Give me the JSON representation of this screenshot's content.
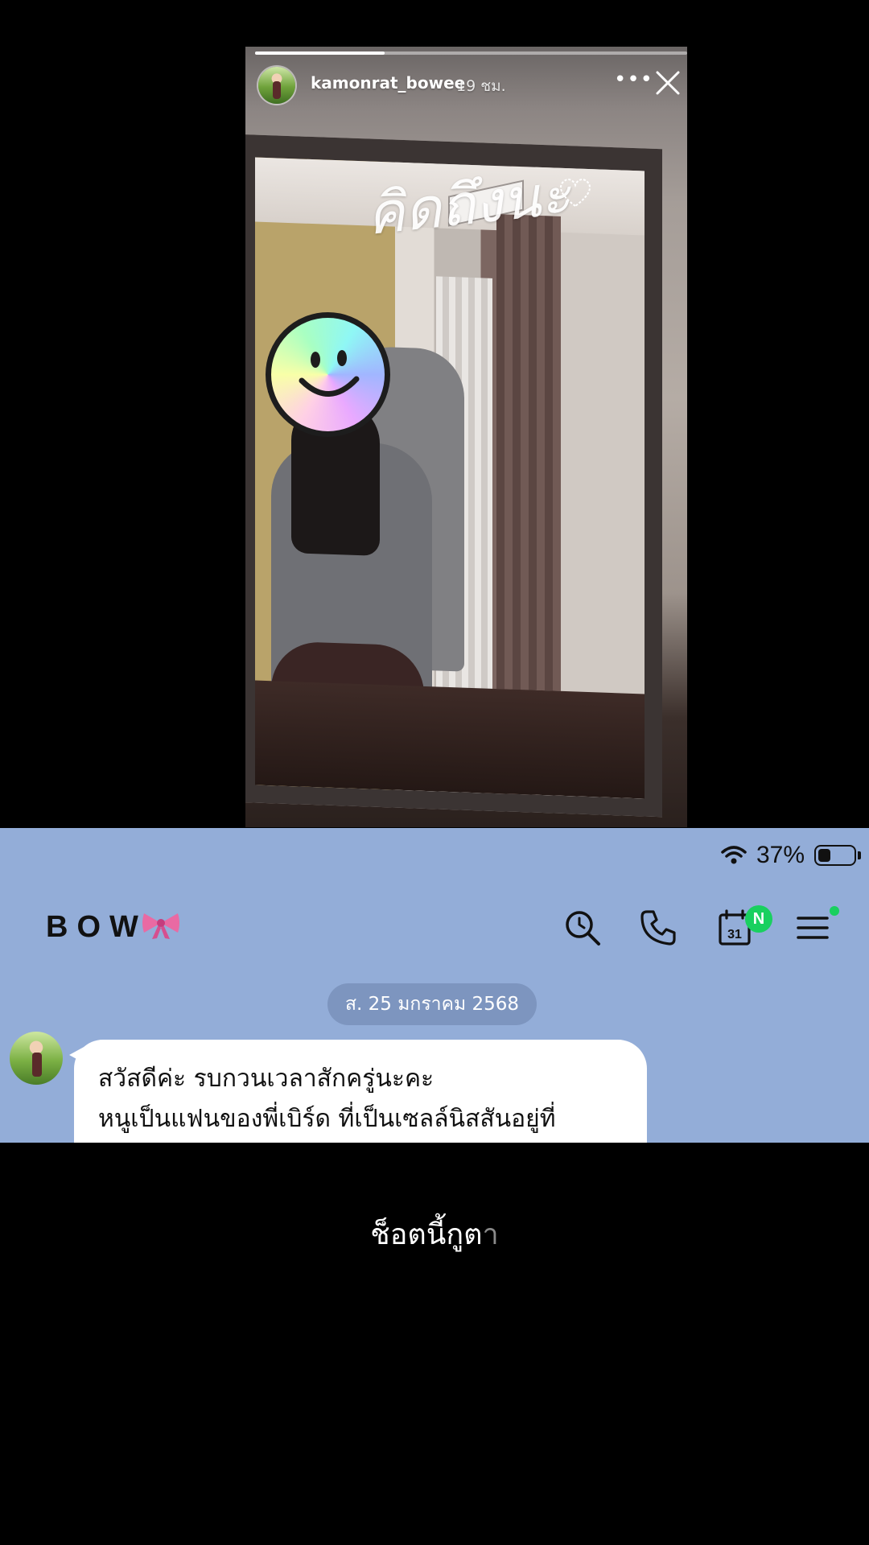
{
  "story": {
    "username": "kamonrat_bowee",
    "time_ago": "19 ชม.",
    "progress": 0.3,
    "caption": "คิดถึงนะ",
    "more_icon": "more-dots-icon",
    "close_icon": "close-icon"
  },
  "chat": {
    "status": {
      "battery_percent": "37%",
      "battery_level": 0.37
    },
    "title": "BOW",
    "title_icon": "bow-ribbon-icon",
    "header_icons": [
      "search-icon",
      "phone-icon",
      "calendar-icon",
      "menu-icon"
    ],
    "calendar_day": "31",
    "badge": "N",
    "date_separator": "ส. 25 มกราคม 2568",
    "message_lines": [
      "สวัสดีค่ะ รบกวนเวลาสักครู่นะคะ",
      "หนูเป็นแฟนของพี่เบิร์ด ที่เป็นเซลล์นิสสันอยู่ที่"
    ]
  },
  "subtitle": {
    "main": "ช็อตนี้กูต",
    "faded": "า"
  },
  "colors": {
    "chat_background": "#93add8",
    "badge_green": "#19d05f",
    "date_pill": "#7d95bf"
  }
}
